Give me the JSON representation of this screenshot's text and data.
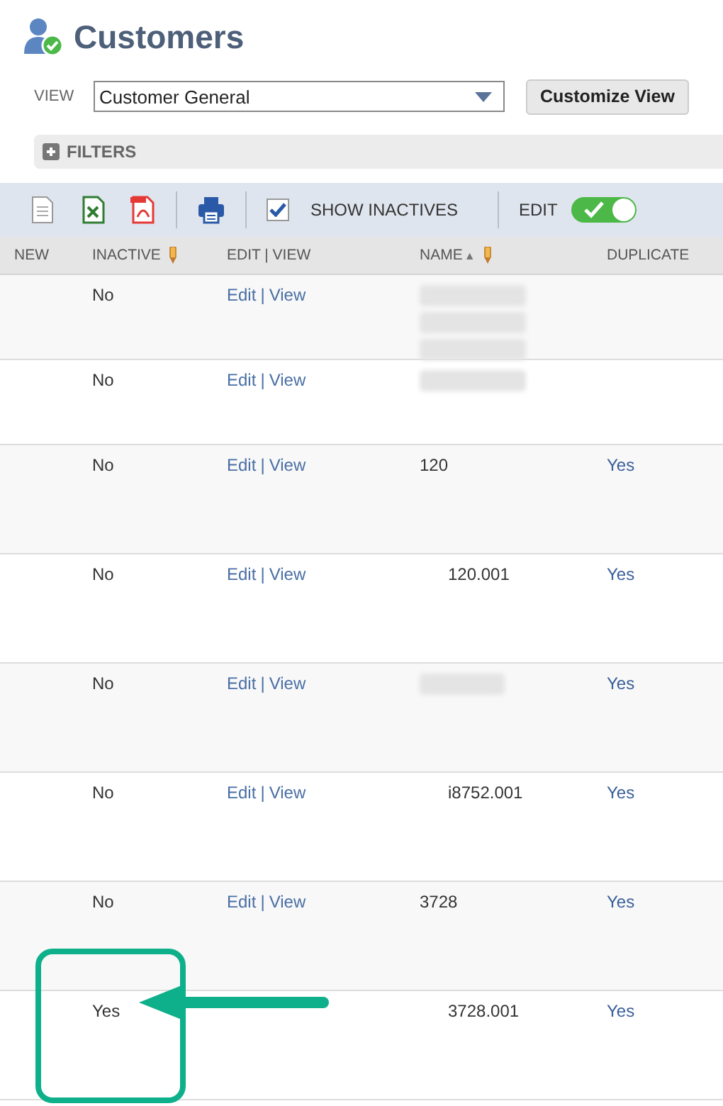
{
  "page": {
    "title": "Customers"
  },
  "view": {
    "label": "VIEW",
    "value": "Customer General",
    "button": "Customize View"
  },
  "filters": {
    "label": "FILTERS",
    "expanded": false
  },
  "toolbar": {
    "show_inactives": {
      "label": "SHOW INACTIVES",
      "checked": true
    },
    "edit": {
      "label": "EDIT",
      "on": true
    }
  },
  "table": {
    "columns": [
      {
        "label": "NEW"
      },
      {
        "label": "INACTIVE",
        "editable": true
      },
      {
        "label": "EDIT | VIEW"
      },
      {
        "label": "NAME",
        "sort_indicator": "▲",
        "editable": true
      },
      {
        "label": "DUPLICATE"
      }
    ],
    "rows": [
      {
        "inactive": "No",
        "edit": "Edit",
        "separator": "|",
        "view": "View",
        "name": {
          "kind": "redacted_block"
        }
      },
      {
        "inactive": "No",
        "edit": "Edit",
        "separator": "|",
        "view": "View",
        "name": {
          "kind": "redacted_line"
        }
      },
      {
        "inactive": "No",
        "edit": "Edit",
        "separator": "|",
        "view": "View",
        "name": {
          "kind": "top",
          "text": "120"
        },
        "duplicate": "Yes"
      },
      {
        "inactive": "No",
        "edit": "Edit",
        "separator": "|",
        "view": "View",
        "name": {
          "kind": "sub",
          "text": "120.001"
        },
        "duplicate": "Yes"
      },
      {
        "inactive": "No",
        "edit": "Edit",
        "separator": "|",
        "view": "View",
        "name": {
          "kind": "redacted_short"
        },
        "duplicate": "Yes"
      },
      {
        "inactive": "No",
        "edit": "Edit",
        "separator": "|",
        "view": "View",
        "name": {
          "kind": "sub",
          "text": "i8752.001"
        },
        "duplicate": "Yes"
      },
      {
        "inactive": "No",
        "edit": "Edit",
        "separator": "|",
        "view": "View",
        "name": {
          "kind": "top",
          "text": "3728"
        },
        "duplicate": "Yes"
      },
      {
        "inactive": "Yes",
        "name": {
          "kind": "sub",
          "text": "3728.001"
        },
        "duplicate": "Yes",
        "highlighted": true
      }
    ]
  }
}
